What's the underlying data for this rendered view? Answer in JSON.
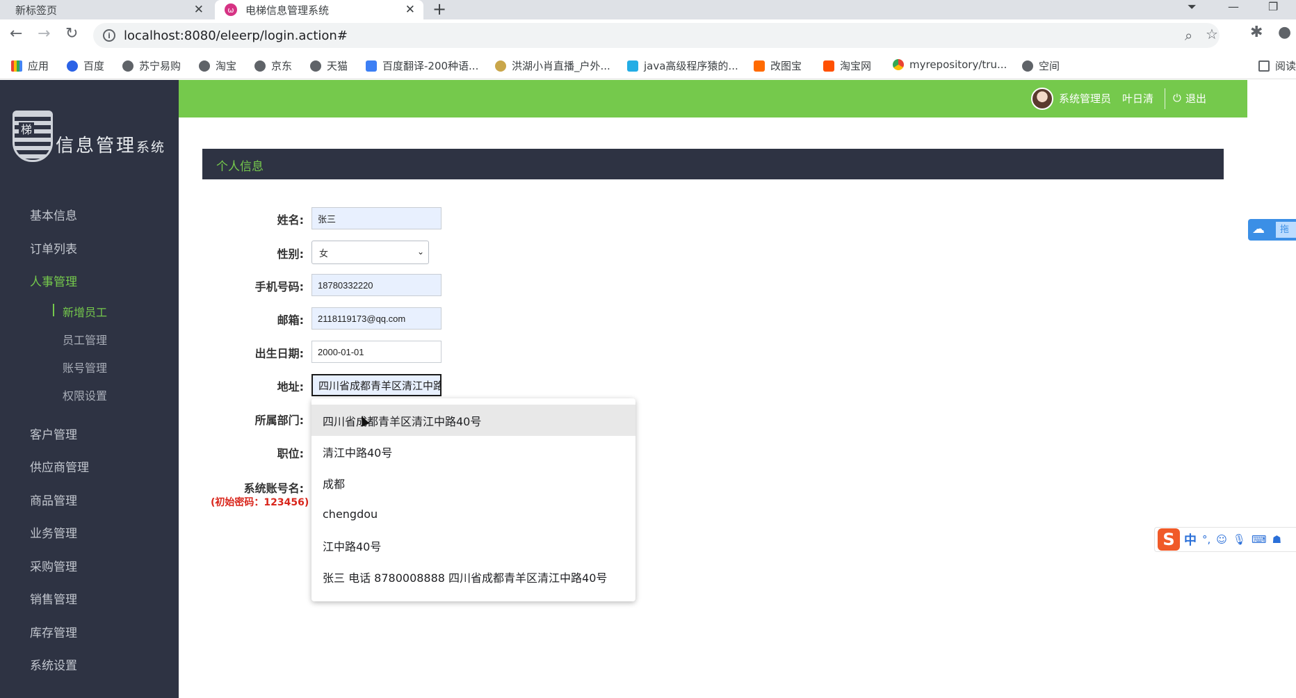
{
  "browser": {
    "tabs": [
      {
        "label": "新标签页",
        "active": false
      },
      {
        "label": "电梯信息管理系统",
        "active": true
      }
    ],
    "new_tab_symbol": "+",
    "url": "localhost:8080/eleerp/login.action#",
    "bookmarks": [
      {
        "label": "应用",
        "icon": "apps-grid-icon"
      },
      {
        "label": "百度",
        "icon": "baidu-paw-icon"
      },
      {
        "label": "苏宁易购",
        "icon": "globe-icon"
      },
      {
        "label": "淘宝",
        "icon": "globe-icon"
      },
      {
        "label": "京东",
        "icon": "globe-icon"
      },
      {
        "label": "天猫",
        "icon": "globe-icon"
      },
      {
        "label": "百度翻译-200种语...",
        "icon": "translate-icon"
      },
      {
        "label": "洪湖小肖直播_户外...",
        "icon": "bird-icon"
      },
      {
        "label": "java高级程序猿的...",
        "icon": "bilibili-tv-icon"
      },
      {
        "label": "改图宝",
        "icon": "orange-square-icon"
      },
      {
        "label": "淘宝网",
        "icon": "taobao-icon"
      },
      {
        "label": "myrepository/tru...",
        "icon": "chrome-icon"
      },
      {
        "label": "空间",
        "icon": "globe-icon"
      },
      {
        "label": "阅读",
        "icon": "reading-list-icon"
      }
    ]
  },
  "app": {
    "logo_main": "信息管理",
    "logo_small": "系统",
    "logo_badge": "梯",
    "user_role": "系统管理员",
    "user_name": "叶日清",
    "logout_label": "退出"
  },
  "sidebar": {
    "items": [
      {
        "label": "基本信息",
        "active": false
      },
      {
        "label": "订单列表",
        "active": false
      },
      {
        "label": "人事管理",
        "active": true
      },
      {
        "label": "客户管理",
        "active": false
      },
      {
        "label": "供应商管理",
        "active": false
      },
      {
        "label": "商品管理",
        "active": false
      },
      {
        "label": "业务管理",
        "active": false
      },
      {
        "label": "采购管理",
        "active": false
      },
      {
        "label": "销售管理",
        "active": false
      },
      {
        "label": "库存管理",
        "active": false
      },
      {
        "label": "系统设置",
        "active": false
      }
    ],
    "subitems": [
      {
        "label": "新增员工",
        "active": true
      },
      {
        "label": "员工管理",
        "active": false
      },
      {
        "label": "账号管理",
        "active": false
      },
      {
        "label": "权限设置",
        "active": false
      }
    ]
  },
  "panel": {
    "title": "个人信息"
  },
  "form": {
    "name_label": "姓名:",
    "name_value": "张三",
    "gender_label": "性别:",
    "gender_value": "女",
    "phone_label": "手机号码:",
    "phone_value": "18780332220",
    "email_label": "邮箱:",
    "email_value": "2118119173@qq.com",
    "birth_label": "出生日期:",
    "birth_value": "2000-01-01",
    "address_label": "地址:",
    "address_value": "四川省成都青羊区清江中路",
    "department_label": "所属部门:",
    "position_label": "职位:",
    "account_label": "系统账号名:",
    "password_hint": "(初始密码：123456)"
  },
  "autocomplete": {
    "options": [
      "四川省成都青羊区清江中路40号",
      "清江中路40号",
      "成都",
      "chengdou",
      "江中路40号",
      "张三  电话 8780008888   四川省成都青羊区清江中路40号"
    ],
    "hovered_index": 0
  },
  "widgets": {
    "cloud_tab_label": "拖",
    "ime_lang": "中"
  },
  "colors": {
    "accent_green": "#75c94c",
    "sidebar_bg": "#2e3343",
    "hint_red": "#d9261c"
  }
}
